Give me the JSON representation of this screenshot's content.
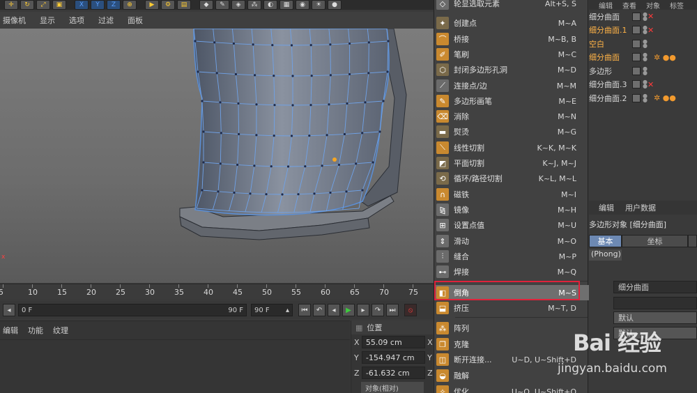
{
  "colors": {
    "menu_bg": "#414141",
    "selected_bg": "#6f6f6f",
    "highlight_border": "#e0223a",
    "selection_blue": "#5b8fd6",
    "vertex_dot": "#1e2a4a",
    "active_point": "#f5a623",
    "object_orange": "#ffb347"
  },
  "toolbar": {
    "icons": [
      "move-icon",
      "rotate-icon",
      "scale-icon",
      "cube-icon",
      "x-axis-icon",
      "y-axis-icon",
      "z-axis-icon",
      "world-icon",
      "render-icon",
      "render-settings-icon",
      "render-view-icon",
      "cube-primitive-icon",
      "pen-icon",
      "subdivide-icon",
      "array-icon",
      "deformer-icon",
      "floor-icon",
      "camera-icon",
      "light-icon",
      "sphere-icon"
    ]
  },
  "viewport_menu": [
    "摄像机",
    "显示",
    "选项",
    "过滤",
    "面板"
  ],
  "timeline": {
    "ticks": [
      "5",
      "10",
      "15",
      "20",
      "25",
      "30",
      "35",
      "40",
      "45",
      "50",
      "55",
      "60",
      "65",
      "70",
      "75"
    ],
    "start_frame": "0 F",
    "end_frame": "90 F",
    "end_field": "90 F"
  },
  "material_menu": [
    "编辑",
    "功能",
    "纹理"
  ],
  "coordinates": {
    "title": "位置",
    "rows": [
      {
        "axis": "X",
        "value": "55.09 cm",
        "axis2": "X"
      },
      {
        "axis": "Y",
        "value": "-154.947 cm",
        "axis2": "Y"
      },
      {
        "axis": "Z",
        "value": "-61.632 cm",
        "axis2": "Z"
      }
    ],
    "mode": "对象(相对)"
  },
  "context_menu": {
    "items": [
      {
        "label": "轮显选取元素",
        "shortcut": "Alt+S, S",
        "icon": "hide-icon",
        "color": "#6b6b6b"
      },
      {
        "label": "创建点",
        "shortcut": "M~A",
        "icon": "create-point-icon",
        "color": "#7a6a4a"
      },
      {
        "label": "桥接",
        "shortcut": "M~B, B",
        "icon": "bridge-icon",
        "color": "#c9892f"
      },
      {
        "label": "笔刷",
        "shortcut": "M~C",
        "icon": "brush-icon",
        "color": "#c9892f"
      },
      {
        "label": "封闭多边形孔洞",
        "shortcut": "M~D",
        "icon": "close-hole-icon",
        "color": "#7a6a4a"
      },
      {
        "label": "连接点/边",
        "shortcut": "M~M",
        "icon": "connect-icon",
        "color": "#6b6b6b"
      },
      {
        "label": "多边形画笔",
        "shortcut": "M~E",
        "icon": "polygon-pen-icon",
        "color": "#c9892f"
      },
      {
        "label": "消除",
        "shortcut": "M~N",
        "icon": "dissolve-icon",
        "color": "#c9892f"
      },
      {
        "label": "熨烫",
        "shortcut": "M~G",
        "icon": "iron-icon",
        "color": "#7a6a4a"
      },
      {
        "label": "线性切割",
        "shortcut": "K~K, M~K",
        "icon": "line-cut-icon",
        "color": "#c9892f"
      },
      {
        "label": "平面切割",
        "shortcut": "K~J, M~J",
        "icon": "plane-cut-icon",
        "color": "#7a6a4a"
      },
      {
        "label": "循环/路径切割",
        "shortcut": "K~L, M~L",
        "icon": "loop-cut-icon",
        "color": "#7a6a4a"
      },
      {
        "label": "磁铁",
        "shortcut": "M~I",
        "icon": "magnet-icon",
        "color": "#c9892f"
      },
      {
        "label": "镜像",
        "shortcut": "M~H",
        "icon": "mirror-icon",
        "color": "#6b6b6b"
      },
      {
        "label": "设置点值",
        "shortcut": "M~U",
        "icon": "set-value-icon",
        "color": "#6b6b6b"
      },
      {
        "label": "滑动",
        "shortcut": "M~O",
        "icon": "slide-icon",
        "color": "#6b6b6b"
      },
      {
        "label": "缝合",
        "shortcut": "M~P",
        "icon": "stitch-icon",
        "color": "#6b6b6b"
      },
      {
        "label": "焊接",
        "shortcut": "M~Q",
        "icon": "weld-icon",
        "color": "#6b6b6b"
      },
      {
        "label": "倒角",
        "shortcut": "M~S",
        "icon": "bevel-icon",
        "color": "#c9892f",
        "selected": true
      },
      {
        "label": "挤压",
        "shortcut": "M~T, D",
        "icon": "extrude-icon",
        "color": "#c9892f"
      },
      {
        "label": "阵列",
        "shortcut": "",
        "icon": "array-icon",
        "color": "#c9892f"
      },
      {
        "label": "克隆",
        "shortcut": "",
        "icon": "clone-icon",
        "color": "#c9892f"
      },
      {
        "label": "断开连接...",
        "shortcut": "U~D, U~Shift+D",
        "icon": "disconnect-icon",
        "color": "#c9892f"
      },
      {
        "label": "融解",
        "shortcut": "",
        "icon": "melt-icon",
        "color": "#c9892f"
      },
      {
        "label": "优化...",
        "shortcut": "U~O, U~Shift+O",
        "icon": "optimize-icon",
        "color": "#c9892f"
      }
    ]
  },
  "object_manager": {
    "header": [
      "编辑",
      "查看",
      "对象",
      "标签"
    ],
    "objects": [
      {
        "name": "细分曲面",
        "orange": false,
        "x": true,
        "tags": false
      },
      {
        "name": "细分曲面.1",
        "orange": true,
        "x": true,
        "tags": false
      },
      {
        "name": "空白",
        "orange": true,
        "x": false,
        "tags": false
      },
      {
        "name": "细分曲面",
        "orange": true,
        "x": false,
        "tags": true
      },
      {
        "name": "多边形",
        "orange": false,
        "x": false,
        "tags": false
      },
      {
        "name": "细分曲面.3",
        "orange": false,
        "x": true,
        "tags": false
      },
      {
        "name": "细分曲面.2",
        "orange": false,
        "x": false,
        "tags": true
      }
    ]
  },
  "attributes": {
    "menu": [
      "编辑",
      "用户数据"
    ],
    "title": "多边形对象 [细分曲面]",
    "tabs": [
      "基本",
      "坐标"
    ],
    "phong": "(Phong)",
    "name_value": "细分曲面",
    "default1": "默认",
    "default2": "默认"
  },
  "watermark": {
    "brand": "Bai 经验",
    "url": "jingyan.baidu.com"
  }
}
